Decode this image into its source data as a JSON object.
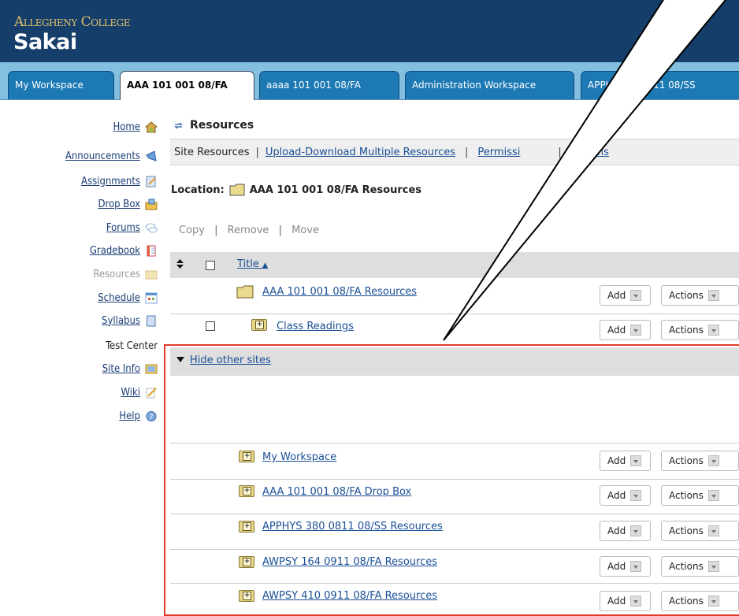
{
  "header": {
    "college": "Allegheny College",
    "app_name": "Sakai"
  },
  "tabs": [
    {
      "label": "My Workspace",
      "selected": false
    },
    {
      "label": "AAA 101 001 08/FA",
      "selected": true
    },
    {
      "label": "aaaa 101 001 08/FA",
      "selected": false
    },
    {
      "label": "Administration Workspace",
      "selected": false
    },
    {
      "label": "APPH",
      "selected": false
    },
    {
      "label": "0811 08/SS",
      "selected": false
    }
  ],
  "nav": [
    {
      "label": "Home",
      "icon": "home-icon"
    },
    {
      "label": "Announcements",
      "icon": "announcements-icon"
    },
    {
      "label": "Assignments",
      "icon": "assignments-icon"
    },
    {
      "label": "Drop Box",
      "icon": "dropbox-icon"
    },
    {
      "label": "Forums",
      "icon": "forums-icon"
    },
    {
      "label": "Gradebook",
      "icon": "gradebook-icon"
    },
    {
      "label": "Resources",
      "icon": "resources-icon"
    },
    {
      "label": "Schedule",
      "icon": "schedule-icon"
    },
    {
      "label": "Syllabus",
      "icon": "syllabus-icon"
    },
    {
      "label": "Test Center",
      "icon": ""
    },
    {
      "label": "Site Info",
      "icon": "siteinfo-icon"
    },
    {
      "label": "Wiki",
      "icon": "wiki-icon"
    },
    {
      "label": "Help",
      "icon": "help-icon"
    }
  ],
  "main": {
    "title": "Resources",
    "subnav": {
      "current": "Site Resources",
      "upload": "Upload-Download Multiple Resources",
      "permissions": "Permissi",
      "options": "Options"
    },
    "location_label": "Location:",
    "location_value": "AAA 101 001 08/FA Resources",
    "actions": {
      "copy": "Copy",
      "remove": "Remove",
      "move": "Move"
    },
    "column_title": "Title",
    "sort_arrow": "▲",
    "add_label": "Add",
    "actions_label": "Actions",
    "rows": [
      {
        "name": "AAA 101 001 08/FA Resources"
      },
      {
        "name": "Class Readings"
      }
    ],
    "other_sites_toggle": "Hide other sites",
    "other_sites": [
      {
        "name": "My Workspace"
      },
      {
        "name": "AAA 101 001 08/FA Drop Box"
      },
      {
        "name": "APPHYS 380 0811 08/SS Resources"
      },
      {
        "name": "AWPSY 164 0911 08/FA Resources"
      },
      {
        "name": "AWPSY 410 0911 08/FA Resources"
      }
    ]
  },
  "colors": {
    "header_bg": "#153e6b",
    "tabbar_bg": "#85bfe0",
    "tab_bg": "#1c79b4",
    "highlight_border": "#e03a26",
    "link": "#1a4f96"
  }
}
